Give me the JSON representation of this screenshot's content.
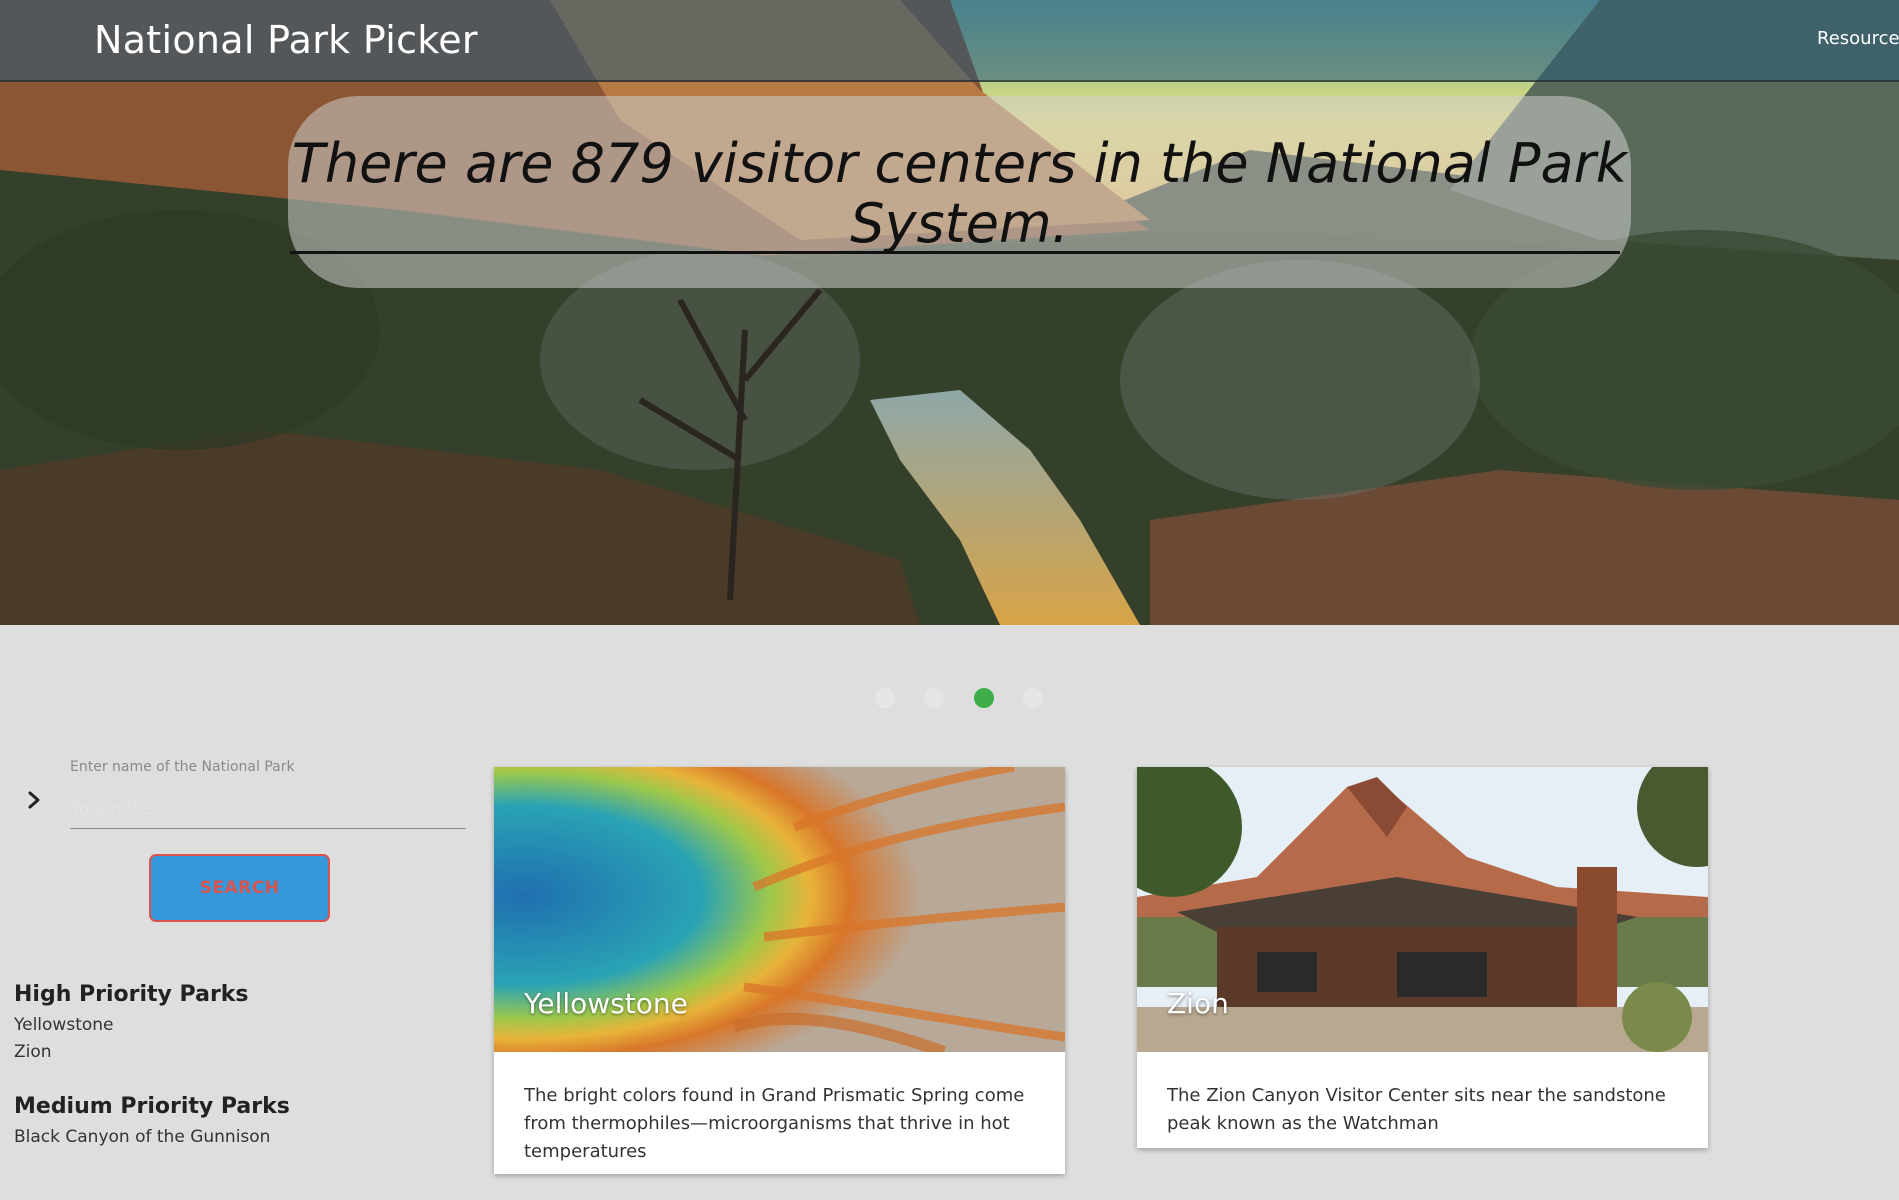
{
  "header": {
    "brand": "National Park Picker",
    "nav_resources": "Resources"
  },
  "hero": {
    "fact": "There are 879 visitor centers in the National Park System."
  },
  "carousel": {
    "slide_count": 4,
    "active_slide": 3
  },
  "search": {
    "label": "Enter name of the National Park",
    "placeholder": "Yosemite",
    "button_label": "SEARCH"
  },
  "priority_lists": {
    "high": {
      "heading": "High Priority Parks",
      "items": [
        "Yellowstone",
        "Zion"
      ]
    },
    "medium": {
      "heading": "Medium Priority Parks",
      "items": [
        "Black Canyon of the Gunnison"
      ]
    }
  },
  "cards": [
    {
      "title": "Yellowstone",
      "description": "The bright colors found in Grand Prismatic Spring come from thermophiles—microorganisms that thrive in hot temperatures"
    },
    {
      "title": "Zion",
      "description": "The Zion Canyon Visitor Center sits near the sandstone peak known as the Watchman"
    }
  ],
  "colors": {
    "page_background": "#dedede",
    "active_dot": "#3fae4a",
    "inactive_dot": "#e6e6e6",
    "search_button_fill": "#3598db",
    "search_button_text": "#d9534f"
  },
  "icons": {
    "search_prefix": "chevron-right-icon"
  }
}
